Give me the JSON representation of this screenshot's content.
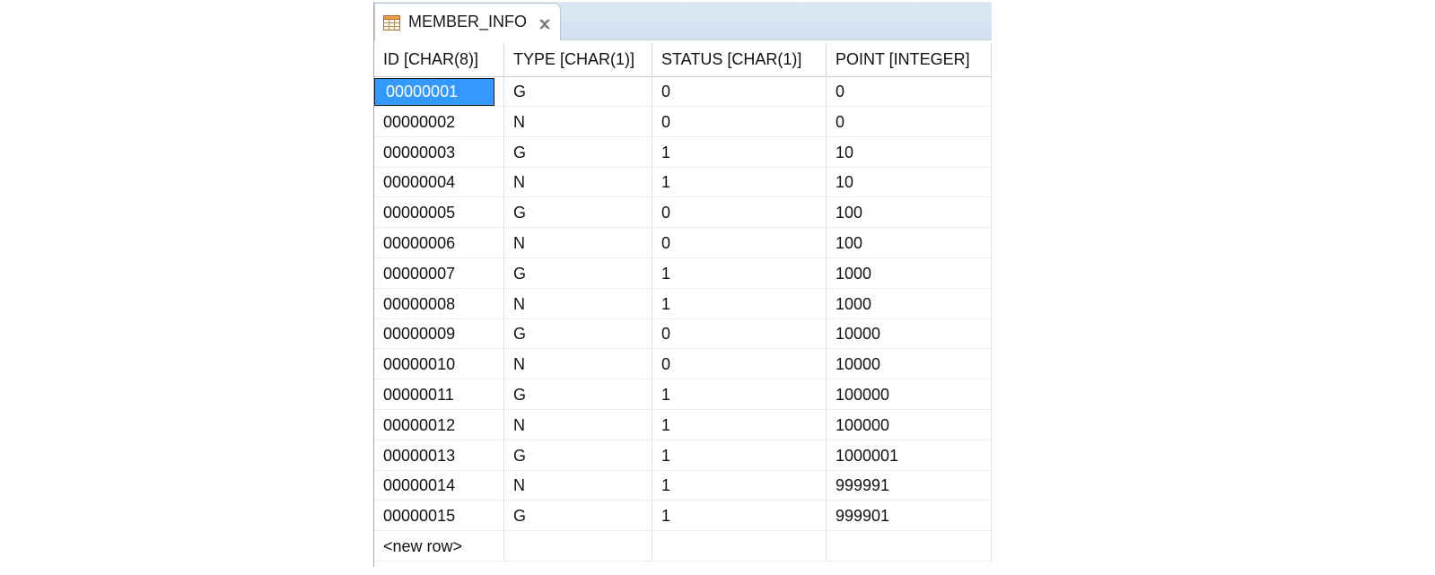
{
  "tab": {
    "title": "MEMBER_INFO",
    "icon": "table-icon",
    "close_icon": "close-icon"
  },
  "table": {
    "columns": [
      "ID [CHAR(8)]",
      "TYPE [CHAR(1)]",
      "STATUS [CHAR(1)]",
      "POINT [INTEGER]"
    ],
    "rows": [
      [
        "00000001",
        "G",
        "0",
        "0"
      ],
      [
        "00000002",
        "N",
        "0",
        "0"
      ],
      [
        "00000003",
        "G",
        "1",
        "10"
      ],
      [
        "00000004",
        "N",
        "1",
        "10"
      ],
      [
        "00000005",
        "G",
        "0",
        "100"
      ],
      [
        "00000006",
        "N",
        "0",
        "100"
      ],
      [
        "00000007",
        "G",
        "1",
        "1000"
      ],
      [
        "00000008",
        "N",
        "1",
        "1000"
      ],
      [
        "00000009",
        "G",
        "0",
        "10000"
      ],
      [
        "00000010",
        "N",
        "0",
        "10000"
      ],
      [
        "00000011",
        "G",
        "1",
        "100000"
      ],
      [
        "00000012",
        "N",
        "1",
        "100000"
      ],
      [
        "00000013",
        "G",
        "1",
        "1000001"
      ],
      [
        "00000014",
        "N",
        "1",
        "999991"
      ],
      [
        "00000015",
        "G",
        "1",
        "999901"
      ]
    ],
    "new_row_label": "<new row>",
    "selected_cell": "00000001"
  },
  "colors": {
    "selection": "#3399ff",
    "tab_strip": "#d3e0f0"
  }
}
